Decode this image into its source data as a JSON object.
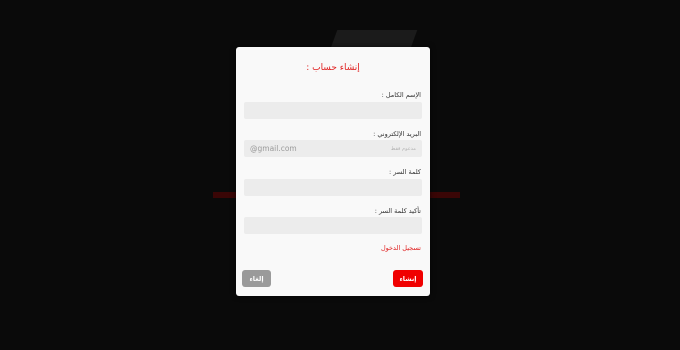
{
  "modal": {
    "title": "إنشاء حساب :",
    "fields": [
      {
        "label": "الإسم الكامل :",
        "value": "",
        "placeholder": ""
      },
      {
        "label": "البريد الإلكتروني :",
        "value": "",
        "placeholder": "@gmail.com",
        "placeholder_hint": "مدعوم فقط"
      },
      {
        "label": "كلمة السر :",
        "value": "",
        "placeholder": ""
      },
      {
        "label": "تأكيد كلمة السر :",
        "value": "",
        "placeholder": ""
      }
    ],
    "login_link": "تسجيل الدخول",
    "create_label": "إنشاء",
    "cancel_label": "إلغاء"
  },
  "colors": {
    "accent": "#e02020",
    "create_button": "#f00000",
    "cancel_button": "#9a9a9a",
    "backdrop": "#0a0a0a",
    "modal_bg": "#f9f9f9"
  }
}
